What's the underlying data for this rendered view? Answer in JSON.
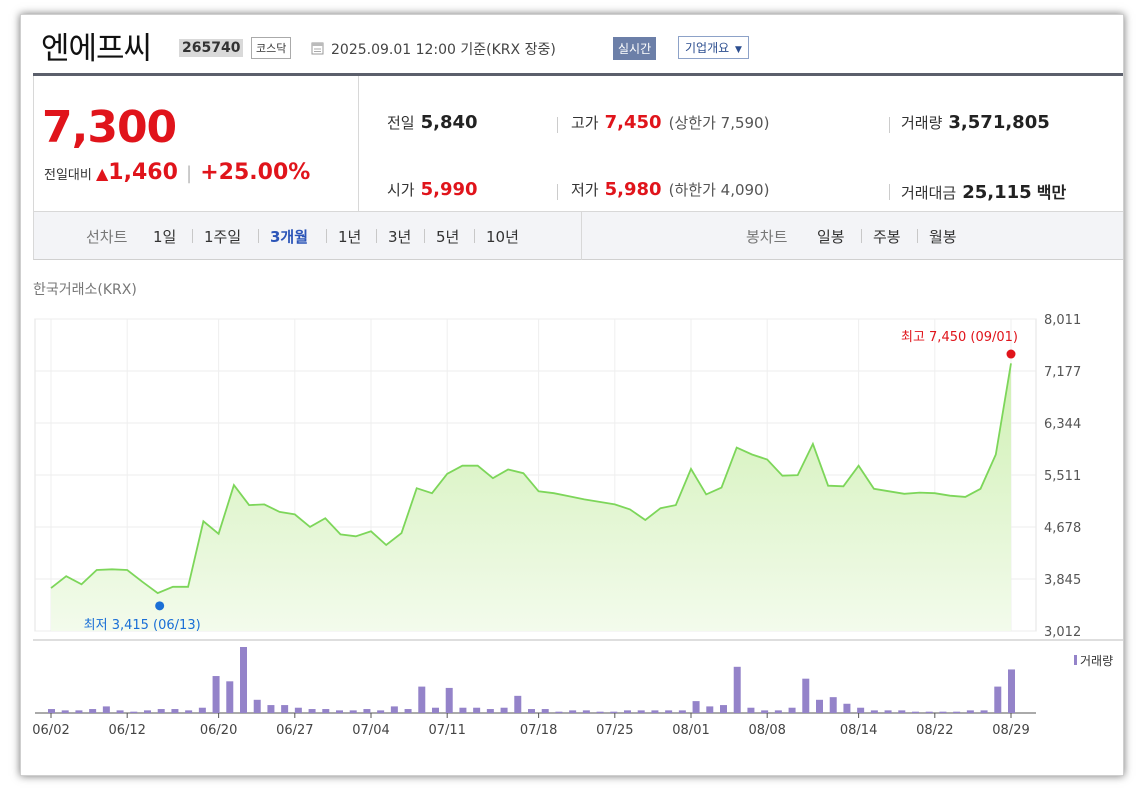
{
  "header": {
    "name": "엔에프씨",
    "code": "265740",
    "market": "코스닥",
    "date_text": "2025.09.01 12:00 기준(KRX 장중)",
    "realtime_label": "실시간",
    "overview_label": "기업개요"
  },
  "price": {
    "current": "7,300",
    "change_label": "전일대비",
    "change_symbol": "▲",
    "change": "1,460",
    "change_rate": "+25.00%"
  },
  "stats": {
    "prev_label": "전일",
    "prev": "5,840",
    "high_label": "고가",
    "high": "7,450",
    "upper_limit_text": "(상한가 7,590)",
    "volume_label": "거래량",
    "volume": "3,571,805",
    "open_label": "시가",
    "open": "5,990",
    "low_label": "저가",
    "low": "5,980",
    "lower_limit_text": "(하한가 4,090)",
    "value_label": "거래대금",
    "value": "25,115",
    "value_unit": "백만"
  },
  "tabs": {
    "line_chart_label": "선차트",
    "periods": [
      "1일",
      "1주일",
      "3개월",
      "1년",
      "3년",
      "5년",
      "10년"
    ],
    "active_period": "3개월",
    "candle_label": "봉차트",
    "candle_periods": [
      "일봉",
      "주봉",
      "월봉"
    ]
  },
  "exchange_label": "한국거래소(KRX)",
  "colors": {
    "up": "#e0141b",
    "line": "#7dd65a",
    "area": "#e3f6d2",
    "volume_bar": "#9483c9",
    "low_marker": "#1a6fd6",
    "active_tab": "#2c55b8"
  },
  "chart_data": {
    "type": "area",
    "y_ticks": [
      "8,011",
      "7,177",
      "6,344",
      "5,511",
      "4,678",
      "3,845",
      "3,012"
    ],
    "ylim": [
      3012,
      8011
    ],
    "x_tick_labels": [
      "06/02",
      "06/12",
      "06/20",
      "06/27",
      "07/04",
      "07/11",
      "07/18",
      "07/25",
      "08/01",
      "08/08",
      "08/14",
      "08/22",
      "08/29"
    ],
    "max_annotation": "최고 7,450 (09/01)",
    "min_annotation": "최저 3,415 (06/13)",
    "volume_legend": "거래량",
    "close": [
      3700,
      3890,
      3760,
      3990,
      4000,
      3990,
      3800,
      3620,
      3720,
      3720,
      4770,
      4570,
      5350,
      5030,
      5040,
      4920,
      4880,
      4680,
      4820,
      4560,
      4530,
      4610,
      4390,
      4580,
      5300,
      5220,
      5530,
      5660,
      5660,
      5460,
      5600,
      5540,
      5250,
      5220,
      5170,
      5120,
      5080,
      5040,
      4960,
      4790,
      4980,
      5030,
      5610,
      5200,
      5310,
      5950,
      5840,
      5760,
      5500,
      5510,
      6010,
      5340,
      5330,
      5660,
      5290,
      5250,
      5210,
      5230,
      5220,
      5180,
      5160,
      5290,
      5840,
      7300
    ],
    "volume": [
      3,
      2,
      2,
      3,
      5,
      2,
      1,
      2,
      3,
      3,
      2,
      4,
      28,
      24,
      50,
      10,
      6,
      6,
      4,
      3,
      3,
      2,
      2,
      3,
      2,
      5,
      3,
      20,
      4,
      19,
      4,
      4,
      3,
      4,
      13,
      3,
      3,
      1,
      2,
      2,
      1,
      1,
      2,
      2,
      2,
      2,
      2,
      9,
      5,
      6,
      35,
      4,
      2,
      2,
      4,
      26,
      10,
      12,
      7,
      4,
      2,
      2,
      2,
      1,
      1,
      1,
      1,
      2,
      2,
      20,
      33
    ]
  }
}
